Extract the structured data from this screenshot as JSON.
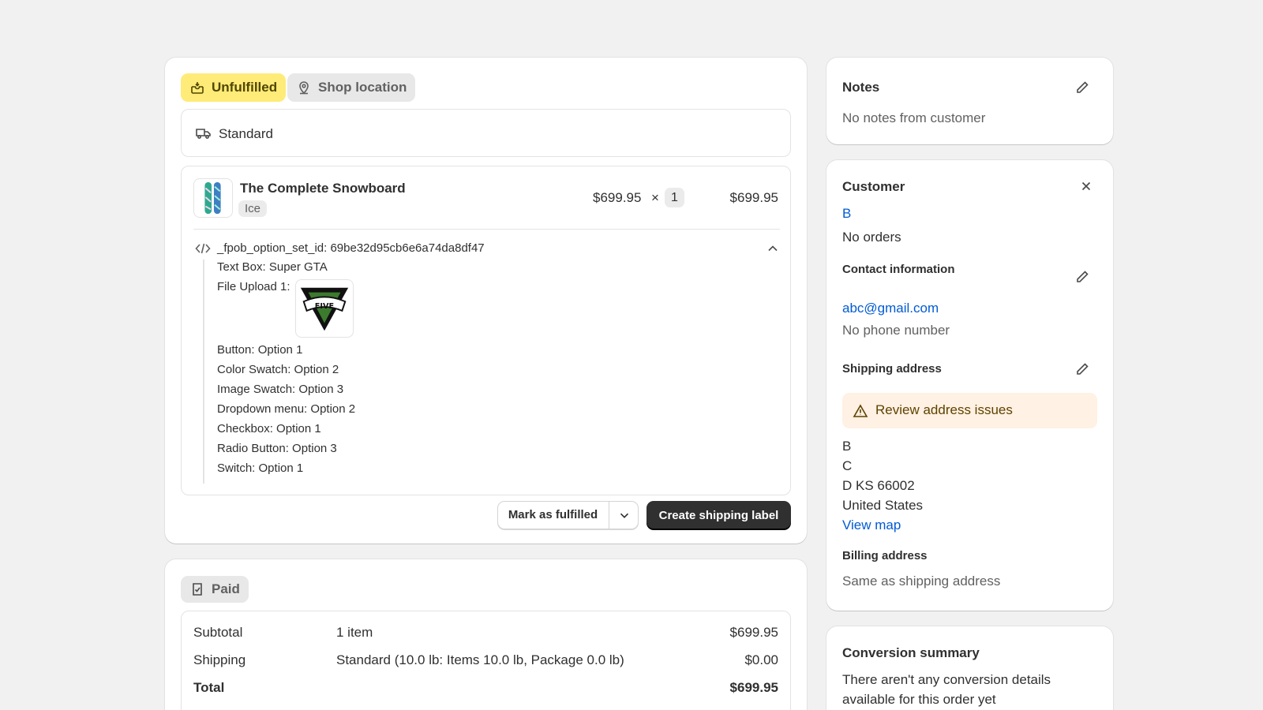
{
  "fulfillment": {
    "status_badge": "Unfulfilled",
    "location_badge": "Shop location",
    "delivery_method": "Standard",
    "product": {
      "name": "The Complete Snowboard",
      "variant": "Ice",
      "unit_price": "$699.95",
      "times": "×",
      "quantity": "1",
      "line_total": "$699.95"
    },
    "properties": {
      "header": "_fpob_option_set_id: 69be32d95cb6e6a74da8df47",
      "items": [
        "Text Box: Super GTA",
        "File Upload 1:",
        "Button: Option 1",
        "Color Swatch: Option 2",
        "Image Swatch: Option 3",
        "Dropdown menu: Option 2",
        "Checkbox: Option 1",
        "Radio Button: Option 3",
        "Switch: Option 1"
      ],
      "upload_image_text": "FIVE"
    },
    "mark_fulfilled_label": "Mark as fulfilled",
    "create_label_label": "Create shipping label"
  },
  "payment": {
    "status_badge": "Paid",
    "rows": [
      {
        "label": "Subtotal",
        "detail": "1 item",
        "amount": "$699.95"
      },
      {
        "label": "Shipping",
        "detail": "Standard (10.0 lb: Items 10.0 lb, Package 0.0 lb)",
        "amount": "$0.00"
      },
      {
        "label": "Total",
        "detail": "",
        "amount": "$699.95"
      }
    ]
  },
  "notes": {
    "title": "Notes",
    "text": "No notes from customer"
  },
  "customer": {
    "title": "Customer",
    "name": "B",
    "orders": "No orders",
    "contact_title": "Contact information",
    "email": "abc@gmail.com",
    "phone": "No phone number",
    "shipping_title": "Shipping address",
    "warning": "Review address issues",
    "address_lines": [
      "B",
      "C",
      "D KS 66002",
      "United States"
    ],
    "view_map": "View map",
    "billing_title": "Billing address",
    "billing_text": "Same as shipping address"
  },
  "conversion": {
    "title": "Conversion summary",
    "text": "There aren't any conversion details available for this order yet"
  },
  "colors": {
    "background": "#f1f1f1",
    "unfulfilled_badge": "#ffeb78",
    "link": "#005bd3",
    "warning_bg": "#fff1e3",
    "primary_button": "#303030"
  }
}
